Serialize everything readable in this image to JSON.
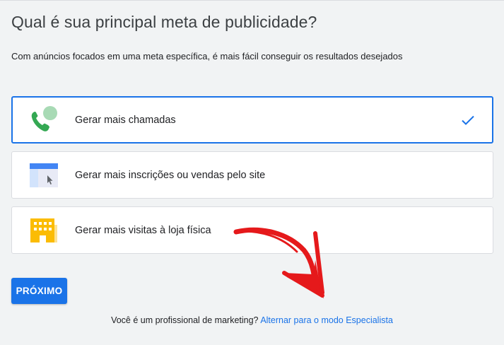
{
  "header": {
    "title": "Qual é sua principal meta de publicidade?",
    "subtitle": "Com anúncios focados em uma meta específica, é mais fácil conseguir os resultados desejados"
  },
  "options": [
    {
      "label": "Gerar mais chamadas",
      "icon": "phone-call-icon",
      "selected": true
    },
    {
      "label": "Gerar mais inscrições ou vendas pelo site",
      "icon": "website-icon",
      "selected": false
    },
    {
      "label": "Gerar mais visitas à loja física",
      "icon": "store-icon",
      "selected": false
    }
  ],
  "actions": {
    "next_label": "PRÓXIMO"
  },
  "footer": {
    "question": "Você é um profissional de marketing?",
    "link": "Alternar para o modo Especialista"
  },
  "colors": {
    "accent": "#1a73e8",
    "background": "#f1f3f4",
    "annotation_arrow": "#e5191b"
  }
}
